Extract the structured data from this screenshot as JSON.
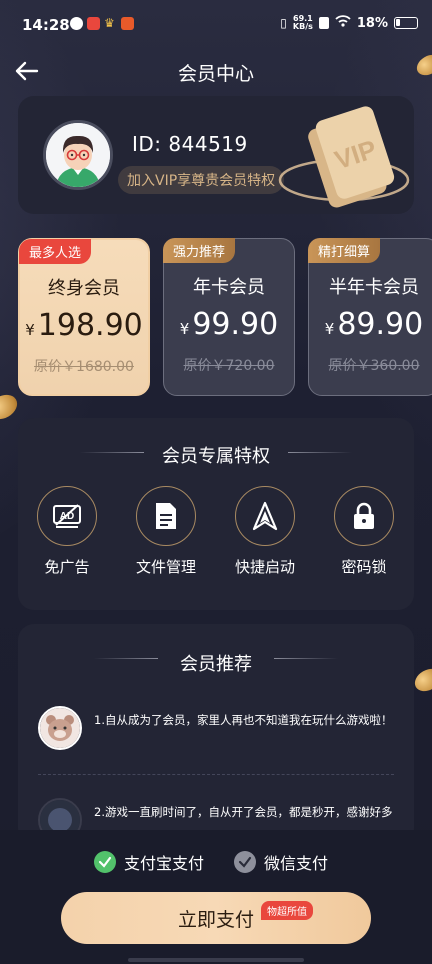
{
  "status_bar": {
    "time": "14:28",
    "net_speed_value": "69.1",
    "net_speed_unit": "KB/s",
    "battery": "18%"
  },
  "header": {
    "title": "会员中心"
  },
  "profile": {
    "id_text": "ID: 844519",
    "vip_prompt": "加入VIP享尊贵会员特权"
  },
  "plans": [
    {
      "tag": "最多人选",
      "name": "终身会员",
      "currency": "¥",
      "price": "198.90",
      "original": "原价￥1680.00",
      "selected": true
    },
    {
      "tag": "强力推荐",
      "name": "年卡会员",
      "currency": "¥",
      "price": "99.90",
      "original": "原价￥720.00",
      "selected": false
    },
    {
      "tag": "精打细算",
      "name": "半年卡会员",
      "currency": "¥",
      "price": "89.90",
      "original": "原价￥360.00",
      "selected": false
    }
  ],
  "privileges": {
    "title": "会员专属特权",
    "items": [
      {
        "label": "免广告",
        "icon": "no-ad-icon"
      },
      {
        "label": "文件管理",
        "icon": "file-icon"
      },
      {
        "label": "快捷启动",
        "icon": "launch-icon"
      },
      {
        "label": "密码锁",
        "icon": "lock-icon"
      }
    ]
  },
  "recommendations": {
    "title": "会员推荐",
    "items": [
      {
        "text": "1.自从成为了会员，家里人再也不知道我在玩什么游戏啦！"
      },
      {
        "text": "2.游戏一直刷时间了，自从开了会员，都是秒开，感谢好多"
      }
    ]
  },
  "payment": {
    "options": [
      {
        "label": "支付宝支付",
        "checked": true
      },
      {
        "label": "微信支付",
        "checked": false
      }
    ],
    "pay_button": "立即支付",
    "pay_badge": "物超所值"
  },
  "colors": {
    "accent_gold": "#d6b487",
    "selected_plan_bg": "#f6dcba",
    "badge_red": "#e9473d",
    "check_green": "#52c26b"
  }
}
